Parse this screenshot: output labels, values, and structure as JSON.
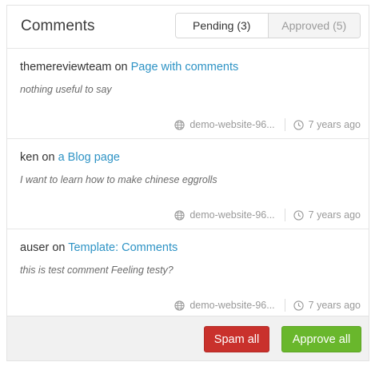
{
  "widget": {
    "title": "Comments",
    "tabs": [
      {
        "label": "Pending (3)",
        "active": true
      },
      {
        "label": "Approved (5)",
        "active": false
      }
    ]
  },
  "comments": [
    {
      "author": "themereviewteam",
      "on": "on",
      "page": "Page with comments",
      "text": "nothing useful to say",
      "site": "demo-website-96...",
      "time": "7 years ago"
    },
    {
      "author": "ken",
      "on": "on",
      "page": "a Blog page",
      "text": "I want to learn how to make chinese eggrolls",
      "site": "demo-website-96...",
      "time": "7 years ago"
    },
    {
      "author": "auser",
      "on": "on",
      "page": "Template: Comments",
      "text": "this is test comment Feeling testy?",
      "site": "demo-website-96...",
      "time": "7 years ago"
    }
  ],
  "footer": {
    "spam_label": "Spam all",
    "approve_label": "Approve all"
  },
  "colors": {
    "link": "#2e93c5",
    "spam": "#c9312c",
    "approve": "#69b72c"
  },
  "icons": {
    "site": "globe-icon",
    "time": "clock-icon"
  }
}
